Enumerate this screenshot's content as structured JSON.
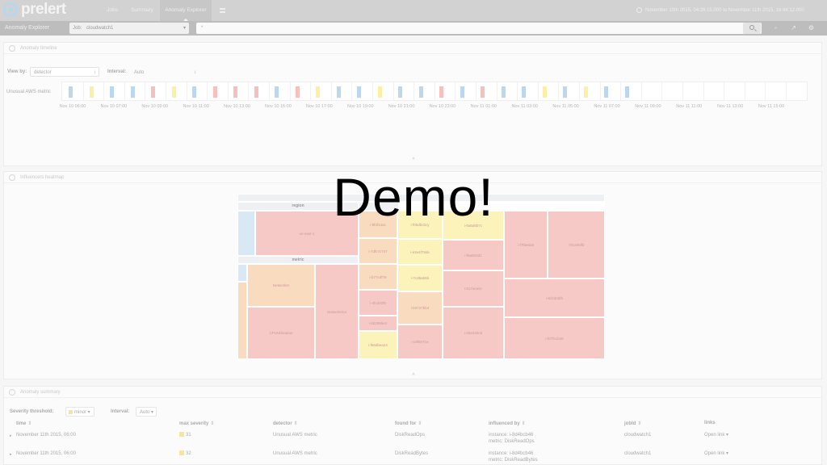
{
  "nav": {
    "logo": "prelert",
    "tabs": [
      "Jobs",
      "Summary",
      "Anomaly Explorer"
    ],
    "active_tab": "Anomaly Explorer",
    "time_range": "November 10th 2015, 04:26:15.000 to November 11th 2015, 16:44:12.000"
  },
  "subbar": {
    "title": "Anomaly Explorer",
    "job_label": "Job:",
    "job_value": "cloudwatch1",
    "query_value": "*"
  },
  "timeline": {
    "header": "Anomaly timeline",
    "view_by_label": "View by:",
    "view_by_value": "detector",
    "interval_label": "Interval:",
    "interval_value": "Auto",
    "swimlane_label": "Unusual AWS metric",
    "ticks": [
      "Nov 10 06:00",
      "Nov 10 07:00",
      "Nov 10 09:00",
      "Nov 10 11:00",
      "Nov 10 13:00",
      "Nov 10 15:00",
      "Nov 10 17:00",
      "Nov 10 19:00",
      "Nov 10 21:00",
      "Nov 10 23:00",
      "Nov 11 01:00",
      "Nov 11 03:00",
      "Nov 11 05:00",
      "Nov 11 07:00",
      "Nov 11 09:00",
      "Nov 11 11:00",
      "Nov 11 13:00",
      "Nov 11 15:00"
    ],
    "bar_severities": [
      "blue",
      "yellow",
      "blue",
      "blue",
      "red",
      "yellow",
      "blue",
      "red",
      "red",
      "red",
      "blue",
      "red",
      "yellow",
      "blue",
      "blue",
      "yellow",
      "blue",
      "blue",
      "red",
      "blue",
      "red",
      "blue",
      "blue",
      "yellow",
      "blue",
      "yellow",
      "blue",
      "blue"
    ]
  },
  "heatmap": {
    "header": "Influencers heatmap",
    "region_title": "region",
    "metric_title": "metric",
    "region_cell": "us-east-1",
    "metric_cells": [
      "NetworkIn",
      "NetworkOut",
      "CPUUtilization"
    ],
    "instance_cells": [
      "i-8f4f14ac",
      "i-7dfc7c747",
      "i-b77cdf78",
      "i-4fcd20f8",
      "i-8b2995e3",
      "i-f66dbea24",
      "i-f05dbcbcy",
      "i-e2e4f78de",
      "i-7cd6ab5b",
      "i-b0727bb4",
      "i-c8f5071e",
      "i-6a5d6b7c",
      "i-f6a903d1",
      "i-817aea6c",
      "i-d4e220c8",
      "i-f7f8e6a9",
      "i-6cbd0df6",
      "i-f6c00dfd",
      "i-f07fecb46"
    ]
  },
  "summary": {
    "header": "Anomaly summary",
    "threshold_label": "Severity threshold:",
    "threshold_value": "minor",
    "interval_label": "Interval:",
    "interval_value": "Auto",
    "columns": [
      "time",
      "max severity",
      "detector",
      "found for",
      "influenced by",
      "jobId",
      "links"
    ],
    "rows": [
      {
        "time": "November 11th 2015, 06:00",
        "severity": "31",
        "detector": "Unusual AWS metric",
        "found_for": "DiskReadOps",
        "influenced_1": "instance: i-8d4bcb46",
        "influenced_2": "metric: DiskReadOps",
        "job": "cloudwatch1",
        "link": "Open link"
      },
      {
        "time": "November 11th 2015, 06:00",
        "severity": "32",
        "detector": "Unusual AWS metric",
        "found_for": "DiskReadBytes",
        "influenced_1": "instance: i-8d4bcb46",
        "influenced_2": "metric: DiskReadBytes",
        "job": "cloudwatch1",
        "link": "Open link"
      }
    ]
  },
  "overlay": {
    "text": "Demo!"
  },
  "colors": {
    "red": "#f7c9c6",
    "yellow": "#fbf3b9",
    "blue": "#c6dff2",
    "orange": "#f9dcbf"
  }
}
